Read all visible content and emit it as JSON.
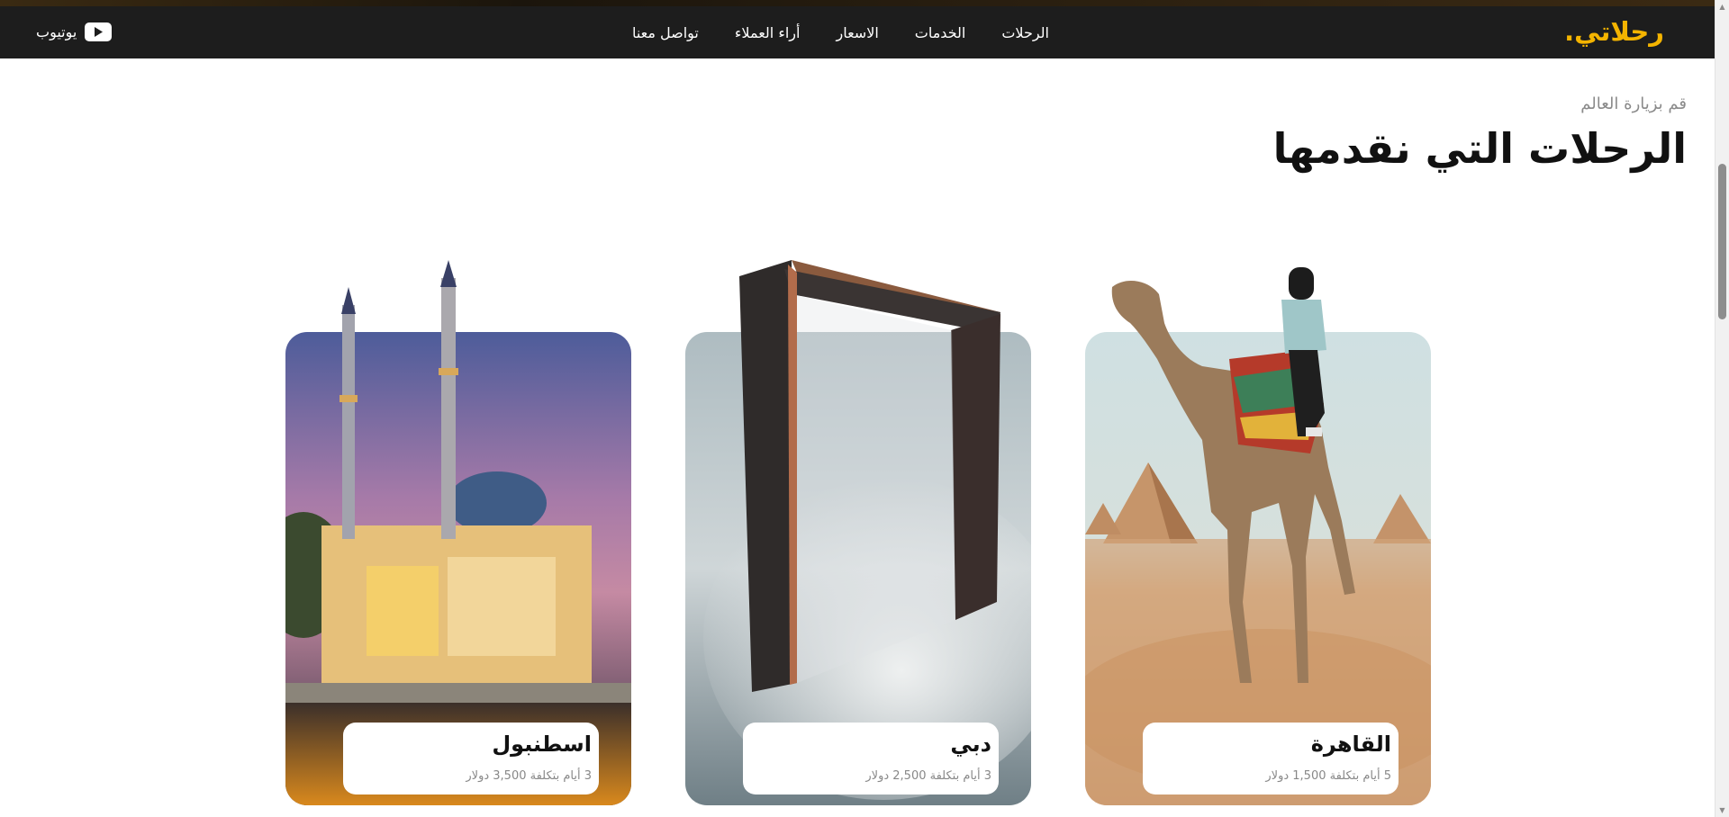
{
  "brand": {
    "logo": "رحلاتي."
  },
  "nav": {
    "links": [
      {
        "label": "الرحلات"
      },
      {
        "label": "الخدمات"
      },
      {
        "label": "الاسعار"
      },
      {
        "label": "أراء العملاء"
      },
      {
        "label": "تواصل معنا"
      }
    ],
    "youtube": {
      "label": "يوتيوب",
      "icon": "youtube-icon"
    }
  },
  "section": {
    "subtitle": "قم بزيارة العالم",
    "title": "الرحلات التي نقدمها"
  },
  "trips": [
    {
      "name": "القاهرة",
      "details": "5 أيام بتكلفة 1,500 دولار",
      "image": "camel-pyramids-image"
    },
    {
      "name": "دبي",
      "details": "3 أيام بتكلفة 2,500 دولار",
      "image": "dubai-frame-image"
    },
    {
      "name": "اسطنبول",
      "details": "3 أيام بتكلفة 3,500 دولار",
      "image": "istanbul-mosque-image"
    }
  ],
  "colors": {
    "accent": "#f4b400",
    "navbar": "#1d1d1d"
  }
}
